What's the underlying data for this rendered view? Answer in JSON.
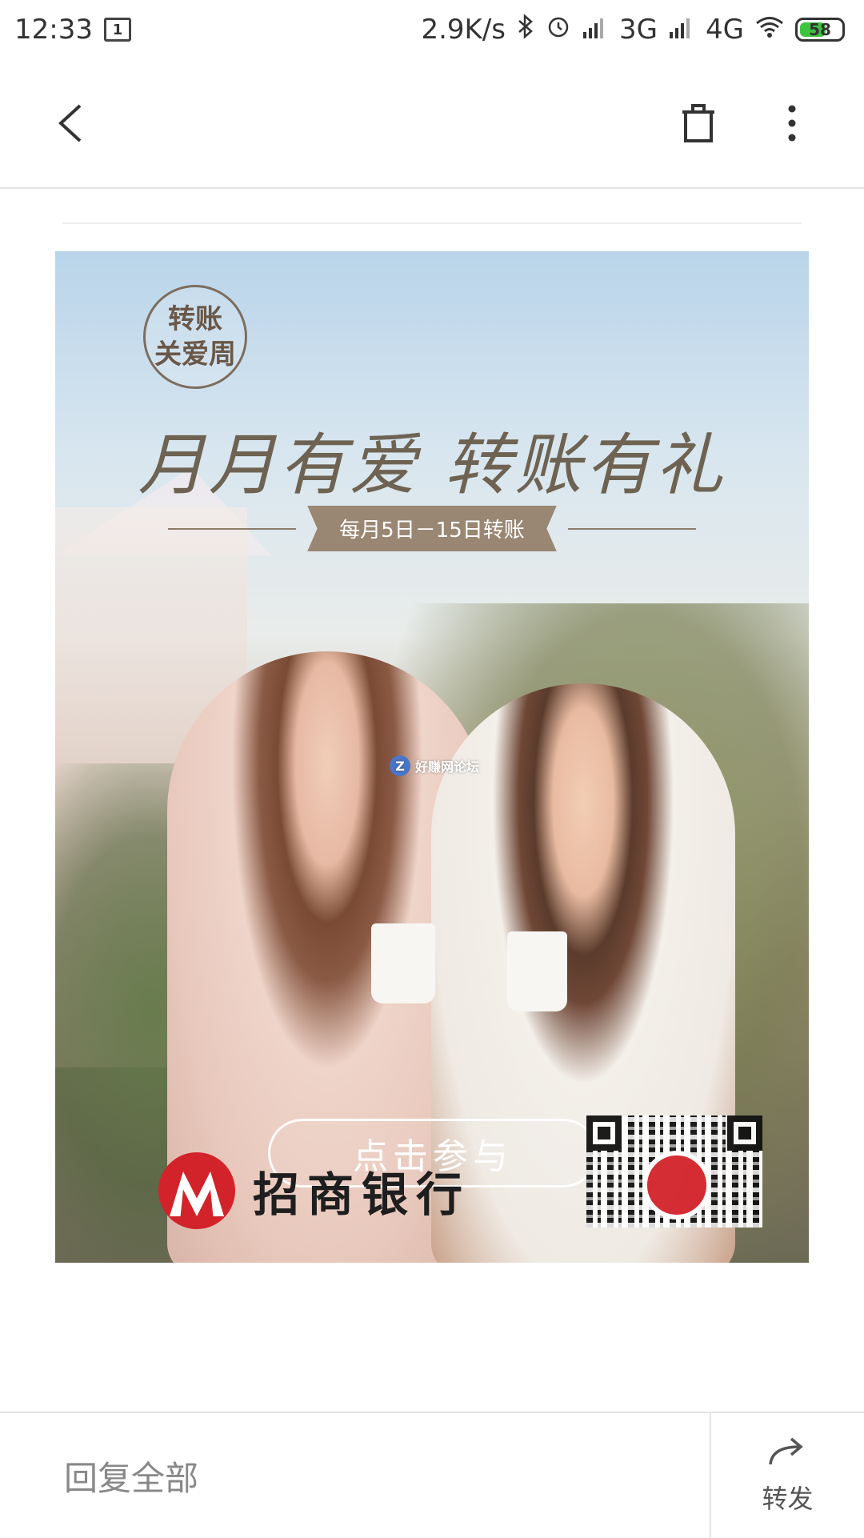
{
  "status_bar": {
    "time": "12:33",
    "notification_badge": "1",
    "net_speed": "2.9K/s",
    "signal1": "3G",
    "signal2": "4G",
    "battery": "58",
    "icons": [
      "bluetooth-icon",
      "alarm-icon",
      "signal-icon",
      "wifi-icon",
      "battery-icon"
    ]
  },
  "toolbar": {
    "icons": [
      "back-arrow-icon",
      "trash-icon",
      "more-vertical-icon"
    ]
  },
  "banner": {
    "logo_line1": "转账",
    "logo_line2": "关爱周",
    "headline": "月月有爱 转账有礼",
    "date_text": "每月5日－15日转账",
    "watermark": "好赚网论坛",
    "cta_label": "点击参与"
  },
  "footer": {
    "bank_name": "招商银行"
  },
  "bottom_bar": {
    "reply_all": "回复全部",
    "forward": "转发"
  },
  "colors": {
    "accent_brown": "#9a8773",
    "bank_red": "#d3232a",
    "divider": "#e4e4e4"
  }
}
